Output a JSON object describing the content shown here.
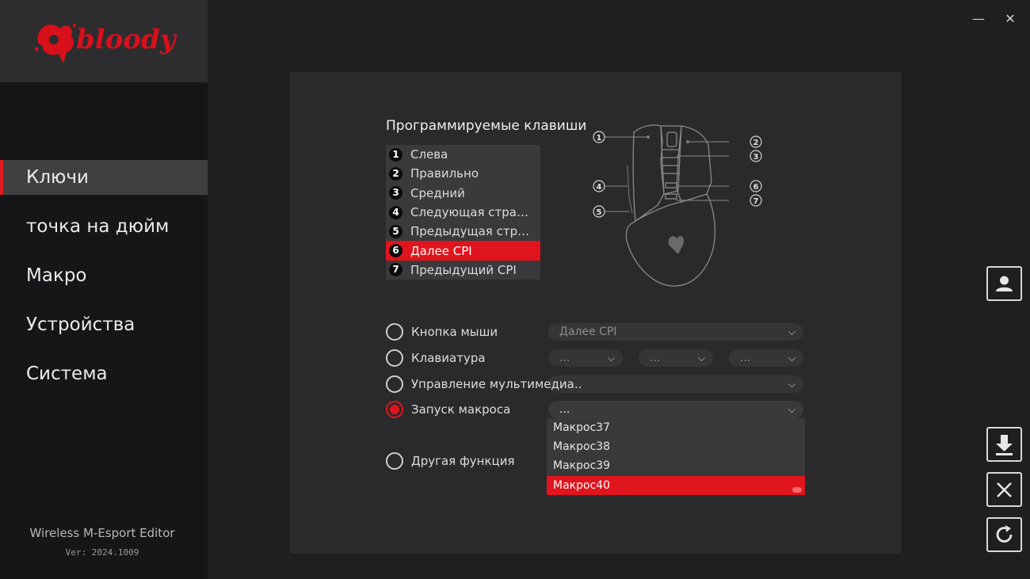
{
  "app": {
    "logo_text": "bloody"
  },
  "window": {
    "minimize": "—",
    "close": "✕"
  },
  "sidebar": {
    "items": [
      {
        "label": "Ключи"
      },
      {
        "label": "точка на дюйм"
      },
      {
        "label": "Макро"
      },
      {
        "label": "Устройства"
      },
      {
        "label": "Система"
      }
    ],
    "active_index": 0,
    "product": "Wireless M-Esport Editor",
    "version": "Ver: 2024.1009"
  },
  "panel": {
    "title": "Программируемые клавиши",
    "keys": [
      {
        "num": "1",
        "label": "Слева"
      },
      {
        "num": "2",
        "label": "Правильно"
      },
      {
        "num": "3",
        "label": "Средний"
      },
      {
        "num": "4",
        "label": "Следующая стран..."
      },
      {
        "num": "5",
        "label": "Предыдущая стра..."
      },
      {
        "num": "6",
        "label": "Далее CPI"
      },
      {
        "num": "7",
        "label": "Предыдущий CPI"
      }
    ],
    "selected_key": 5,
    "diagram_numbers": [
      "1",
      "2",
      "3",
      "4",
      "5",
      "6",
      "7"
    ]
  },
  "options": {
    "mouse_button": {
      "label": "Кнопка мыши",
      "value": "Далее CPI"
    },
    "keyboard": {
      "label": "Клавиатура",
      "values": [
        "...",
        "...",
        "..."
      ]
    },
    "multimedia": {
      "label": "Управление мультимедиа.."
    },
    "macro": {
      "label": "Запуск макроса",
      "value": "..."
    },
    "other": {
      "label": "Другая функция"
    },
    "selected": "macro"
  },
  "macro_dropdown": {
    "items": [
      "Макрос37",
      "Макрос38",
      "Макрос39",
      "Макрос40"
    ],
    "selected_index": 3
  },
  "side_buttons": [
    "profile-icon",
    "download-icon",
    "close-icon",
    "refresh-icon"
  ],
  "colors": {
    "accent": "#e0141c",
    "panel": "#2a2a2c",
    "background": "#1f1f21"
  }
}
